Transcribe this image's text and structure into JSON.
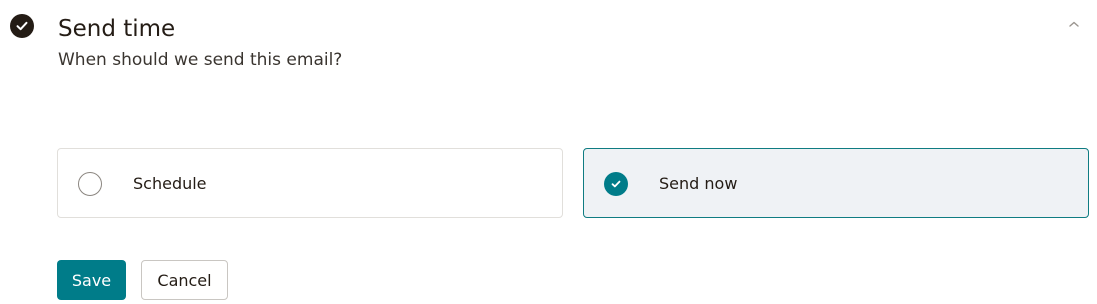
{
  "section": {
    "status_icon": "check-circle-icon",
    "title": "Send time",
    "subtitle": "When should we send this email?",
    "collapse_icon": "chevron-up-icon"
  },
  "options": [
    {
      "label": "Schedule",
      "selected": false
    },
    {
      "label": "Send now",
      "selected": true
    }
  ],
  "actions": {
    "save_label": "Save",
    "cancel_label": "Cancel"
  },
  "colors": {
    "accent": "#007c89",
    "selected_border": "#0f7c82",
    "selected_background": "#eff2f5",
    "text": "#241c15"
  }
}
